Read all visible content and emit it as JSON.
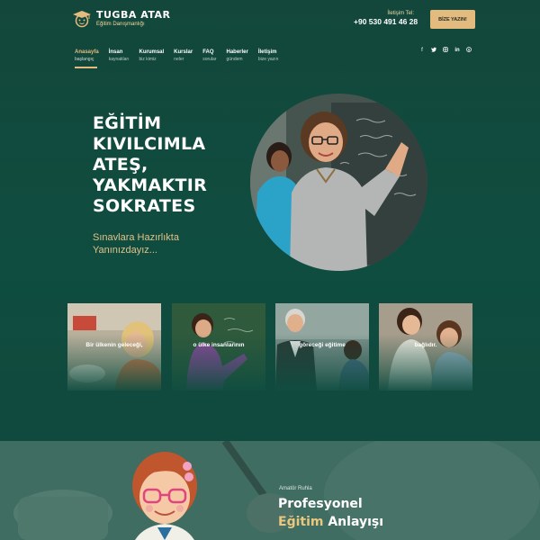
{
  "brand": {
    "name": "TUGBA ATAR",
    "tagline": "Eğitim Danışmanlığı"
  },
  "header": {
    "contact_label": "İletişim Tel:",
    "phone": "+90 530 491 46 28",
    "cta_label": "BİZE YAZIN!"
  },
  "nav": {
    "items": [
      {
        "title": "Anasayfa",
        "subtitle": "başlangıç"
      },
      {
        "title": "İnsan",
        "subtitle": "kaynakları"
      },
      {
        "title": "Kurumsal",
        "subtitle": "biz kimiz"
      },
      {
        "title": "Kurslar",
        "subtitle": "neler"
      },
      {
        "title": "FAQ",
        "subtitle": "sorular"
      },
      {
        "title": "Haberler",
        "subtitle": "gündem"
      },
      {
        "title": "İletişim",
        "subtitle": "bize yazın"
      }
    ],
    "active_index": 0
  },
  "social": {
    "icons": [
      "facebook-icon",
      "twitter-icon",
      "instagram-icon",
      "linkedin-icon",
      "skype-icon"
    ]
  },
  "hero": {
    "title_lines": [
      "EĞİTİM",
      "KIVILCIMLA",
      "ATEŞ,",
      "YAKMAKTIR",
      "SOKRATES"
    ],
    "subtitle_lines": [
      "Sınavlara Hazırlıkta",
      "Yanınızdayız..."
    ]
  },
  "cards": [
    {
      "caption": "Bir ülkenin geleceği,"
    },
    {
      "caption": "o ülke insanlarının"
    },
    {
      "caption": "göreceği eğitime"
    },
    {
      "caption": "bağlıdır."
    }
  ],
  "section2": {
    "kicker": "Amatör Ruhla",
    "title_line1": "Profesyonel",
    "title_line2_accent": "Eğitim",
    "title_line2_rest": " Anlayışı"
  },
  "colors": {
    "background": "#0f4a3d",
    "accent": "#e4bb7e",
    "section2_bg": "#3e6a60"
  }
}
